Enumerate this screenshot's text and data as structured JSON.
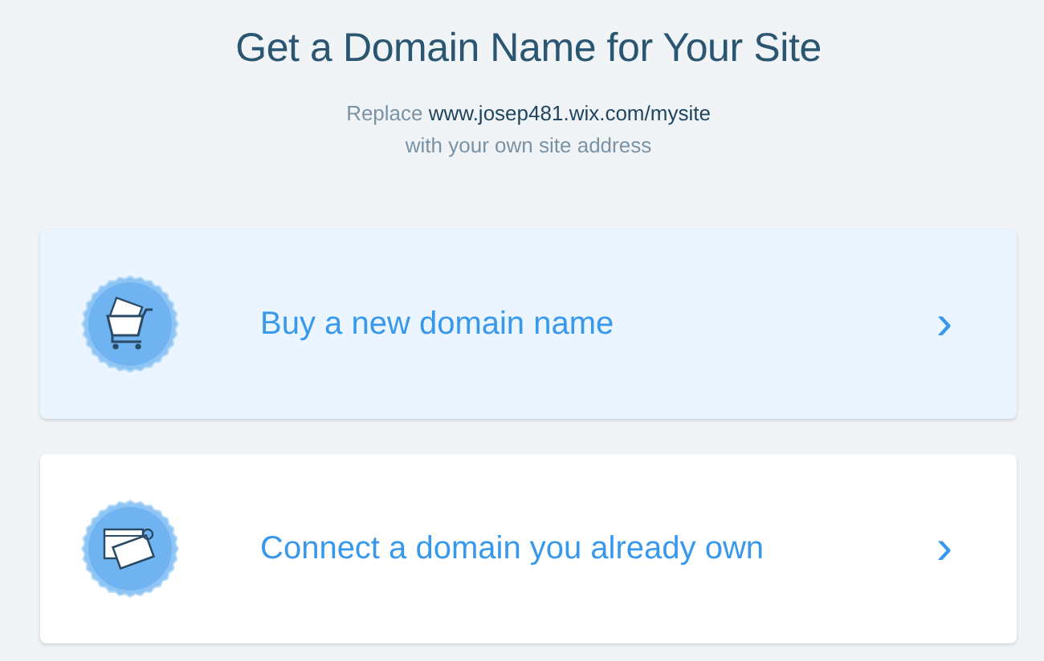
{
  "title": "Get a Domain Name for Your Site",
  "subtitle": "Replace **www.josep481.wix.com/mysite**\nwith your own site address",
  "options": [
    {
      "kind": "buy",
      "label": "Buy a new domain name",
      "arrow": "›",
      "selected": true
    },
    {
      "kind": "connect",
      "label": "Connect a domain you already own",
      "arrow": "›",
      "selected": false
    }
  ]
}
